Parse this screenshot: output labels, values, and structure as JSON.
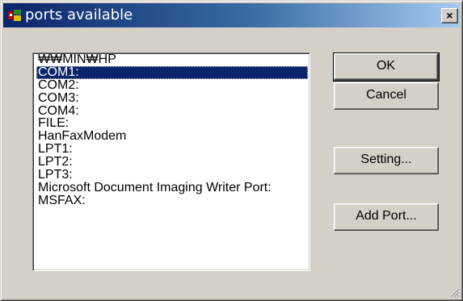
{
  "window": {
    "title": "ports available",
    "close_label": "×"
  },
  "ports": {
    "items": [
      "₩₩MIN₩HP",
      "COM1:",
      "COM2:",
      "COM3:",
      "COM4:",
      "FILE:",
      "HanFaxModem",
      "LPT1:",
      "LPT2:",
      "LPT3:",
      "Microsoft Document Imaging Writer Port:",
      "MSFAX:"
    ],
    "selected_index": 1
  },
  "buttons": {
    "ok": "OK",
    "cancel": "Cancel",
    "setting": "Setting...",
    "add_port": "Add Port..."
  },
  "colors": {
    "titlebar_start": "#0a246a",
    "titlebar_end": "#a6caf0",
    "dialog_face": "#d4d0c8",
    "selection": "#0a246a"
  },
  "icons": {
    "title": "printer-icon",
    "close": "close-icon",
    "resize": "resize-grip-icon"
  }
}
